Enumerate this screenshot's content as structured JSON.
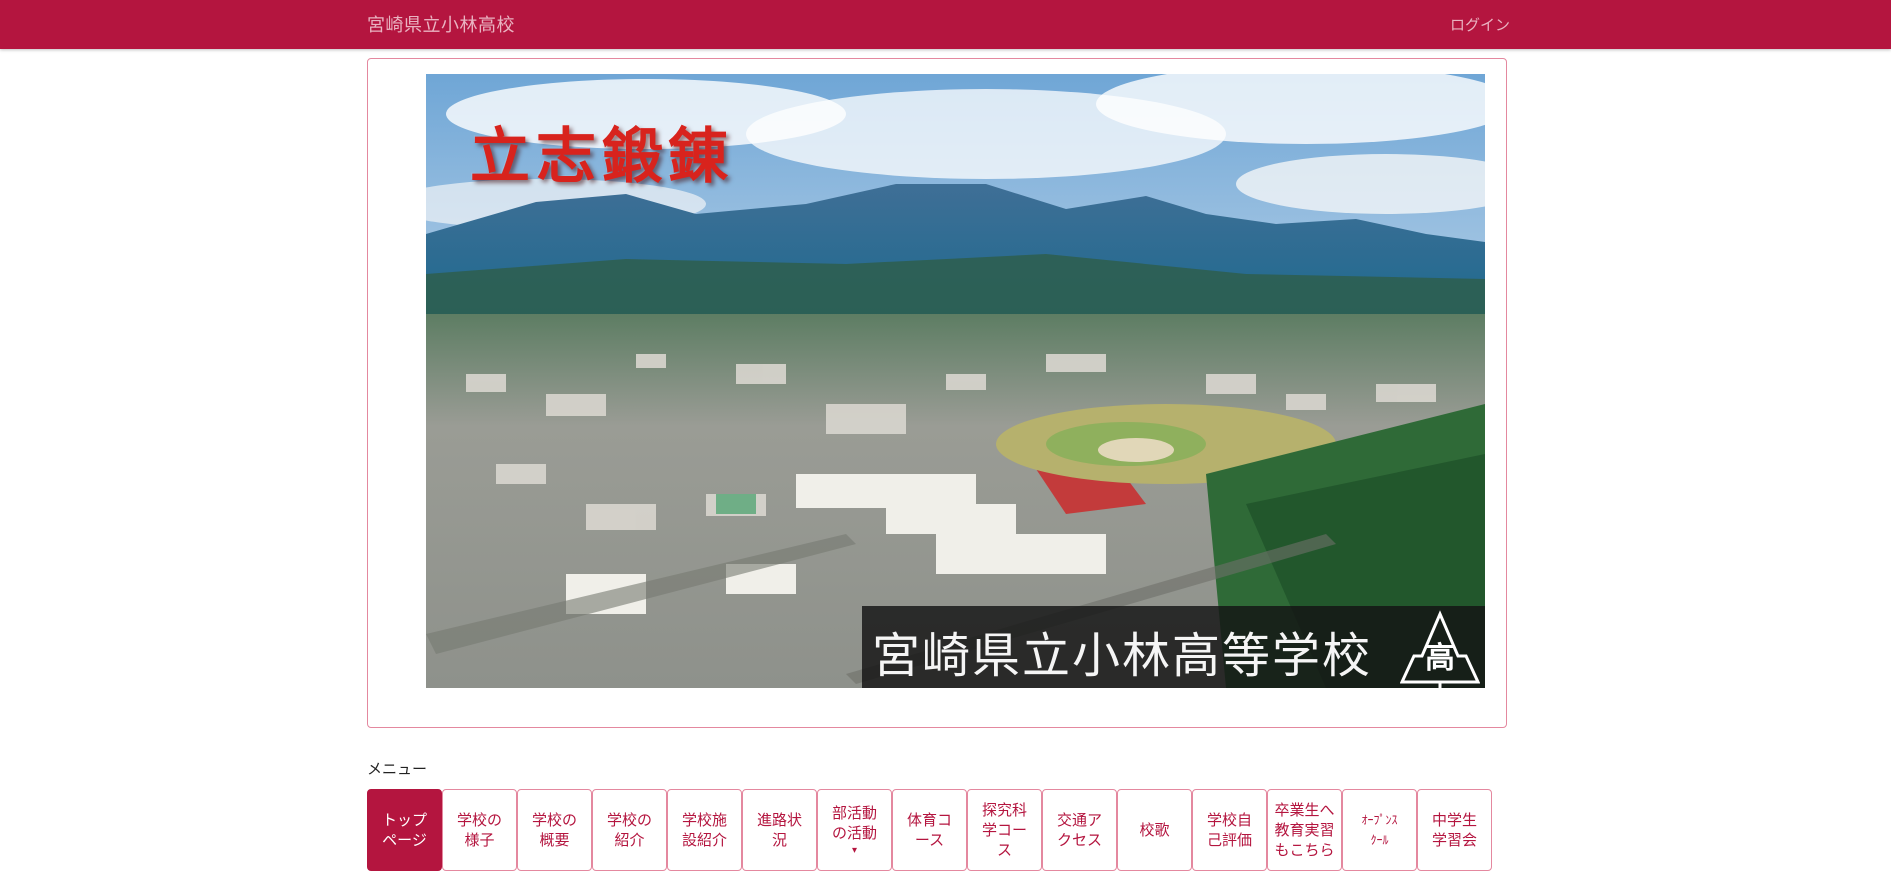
{
  "header": {
    "site_title": "宮崎県立小林高校",
    "login_label": "ログイン"
  },
  "banner": {
    "motto": "立志鍛錬",
    "school_name": "宮崎県立小林高等学校",
    "emblem_text": "高"
  },
  "menu": {
    "heading": "メニュー",
    "items": [
      {
        "label": "トップ\nページ",
        "active": true
      },
      {
        "label": "学校の\n様子"
      },
      {
        "label": "学校の\n概要"
      },
      {
        "label": "学校の\n紹介"
      },
      {
        "label": "学校施\n設紹介"
      },
      {
        "label": "進路状\n況"
      },
      {
        "label": "部活動\nの活動",
        "has_dropdown": true,
        "caret": "▾"
      },
      {
        "label": "体育コ\nース"
      },
      {
        "label": "探究科\n学コー\nス"
      },
      {
        "label": "交通ア\nクセス"
      },
      {
        "label": "校歌"
      },
      {
        "label": "学校自\n己評価"
      },
      {
        "label": "卒業生へ\n教育実習\nもこちら"
      },
      {
        "label": "ｵｰﾌﾟﾝｽ\nｸｰﾙ",
        "small": true
      },
      {
        "label": "中学生\n学習会"
      }
    ]
  },
  "colors": {
    "brand": "#b4153f",
    "border": "#e4889f",
    "header_text": "#e9b3c1"
  }
}
